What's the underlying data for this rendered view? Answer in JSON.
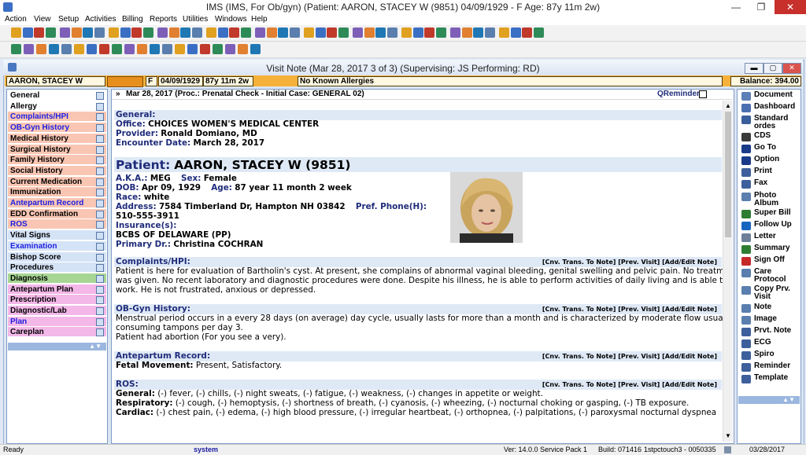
{
  "app": {
    "title": "IMS (IMS, For Ob/gyn)     (Patient: AARON, STACEY W (9851) 04/09/1929 - F Age: 87y 11m 2w)"
  },
  "window_controls": {
    "minimize": "—",
    "maximize": "❐",
    "close": "✕"
  },
  "menu": [
    "Action",
    "View",
    "Setup",
    "Activities",
    "Billing",
    "Reports",
    "Utilities",
    "Windows",
    "Help"
  ],
  "visit_window": {
    "title": "Visit Note (Mar 28, 2017    3 of 3) (Supervising: JS Performing: RD)"
  },
  "patient_bar": {
    "name": "AARON, STACEY W",
    "sex": "F",
    "dob": "04/09/1929",
    "age": "87y 11m 2w",
    "allergies": "No Known Allergies",
    "balance": "Balance: 394.00"
  },
  "left_nav": [
    {
      "label": "General",
      "color": "#ffffff",
      "text": "#000000"
    },
    {
      "label": "Allergy",
      "color": "#ffffff",
      "text": "#000000"
    },
    {
      "label": "Complaints/HPI",
      "color": "#f9c6b3",
      "text": "#1d1de0"
    },
    {
      "label": "OB-Gyn History",
      "color": "#f9c6b3",
      "text": "#1d1de0"
    },
    {
      "label": "Medical History",
      "color": "#f9c6b3",
      "text": "#000000"
    },
    {
      "label": "Surgical History",
      "color": "#f9c6b3",
      "text": "#000000"
    },
    {
      "label": "Family History",
      "color": "#f9c6b3",
      "text": "#000000"
    },
    {
      "label": "Social History",
      "color": "#f9c6b3",
      "text": "#000000"
    },
    {
      "label": "Current Medication",
      "color": "#f9c6b3",
      "text": "#000000"
    },
    {
      "label": "Immunization",
      "color": "#f9c6b3",
      "text": "#000000"
    },
    {
      "label": "Antepartum Record",
      "color": "#f9c6b3",
      "text": "#1d1de0"
    },
    {
      "label": "EDD Confirmation",
      "color": "#f9c6b3",
      "text": "#000000"
    },
    {
      "label": "ROS",
      "color": "#f9c6b3",
      "text": "#1d1de0"
    },
    {
      "label": "Vital Signs",
      "color": "#d5e3f6",
      "text": "#000000"
    },
    {
      "label": "Examination",
      "color": "#d5e3f6",
      "text": "#1d1de0"
    },
    {
      "label": "Bishop Score",
      "color": "#d5e3f6",
      "text": "#000000"
    },
    {
      "label": "Procedures",
      "color": "#d5e3f6",
      "text": "#000000"
    },
    {
      "label": "Diagnosis",
      "color": "#a7d694",
      "text": "#000000"
    },
    {
      "label": "Antepartum Plan",
      "color": "#f3b7e8",
      "text": "#000000"
    },
    {
      "label": "Prescription",
      "color": "#f3b7e8",
      "text": "#000000"
    },
    {
      "label": "Diagnostic/Lab",
      "color": "#f3b7e8",
      "text": "#000000"
    },
    {
      "label": "Plan",
      "color": "#f3b7e8",
      "text": "#1d1de0"
    },
    {
      "label": "Careplan",
      "color": "#f3b7e8",
      "text": "#000000"
    }
  ],
  "visit_header": {
    "text": "Mar 28, 2017  (Proc.: Prenatal Check - Initial  Case: GENERAL 02)",
    "qreminder": "QReminder"
  },
  "note": {
    "general_header": "General:",
    "office_label": "Office:",
    "office": "CHOICES WOMEN'S MEDICAL CENTER",
    "provider_label": "Provider:",
    "provider": "Ronald Domiano, MD",
    "encounter_label": "Encounter Date:",
    "encounter": "March 28, 2017",
    "patient_label": "Patient:",
    "patient": "AARON, STACEY W  (9851)",
    "aka_label": "A.K.A.:",
    "aka": "MEG",
    "sex_label": "Sex:",
    "sex": "Female",
    "dob_label": "DOB:",
    "dob": "Apr 09, 1929",
    "age_label": "Age:",
    "age": "87 year 11 month 2 week",
    "race_label": "Race:",
    "race": "white",
    "address_label": "Address:",
    "address": "7584 Timberland Dr, Hampton NH 03842",
    "phone_label": "Pref. Phone(H):",
    "phone": "510-555-3911",
    "insurance_label": "Insurance(s):",
    "insurance": "BCBS OF DELAWARE (PP)",
    "primary_label": "Primary Dr.:",
    "primary": "Christina COCHRAN",
    "link_cnv": "[Cnv. Trans. To Note]",
    "link_prev": "[Prev. Visit]",
    "link_add": "[Add/Edit Note]",
    "hpi_header": "Complaints/HPI:",
    "hpi_1": "Patient is here for evaluation of Bartholin's cyst. At present, she complains of abnormal vaginal bleeding, genital swelling and pelvic pain. No treatment",
    "hpi_2": "was given. No recent laboratory and diagnostic procedures were done. Despite his illness, he is able to perform activities of daily living and is able to",
    "hpi_3": "work. He is not frustrated, anxious or depressed.",
    "obgyn_header": "OB-Gyn History:",
    "obgyn_1": "Menstrual period occurs in a every 28 days (on average)  day cycle, usually lasts for more than a month and is characterized by moderate flow usually",
    "obgyn_2": "consuming tampons per day 3.",
    "obgyn_3": "Patient had abortion (For you see a very).",
    "ante_header": "Antepartum Record:",
    "fetal_label": "Fetal Movement:",
    "fetal": "Present, Satisfactory.",
    "ros_header": "ROS:",
    "ros_gen_label": "General:",
    "ros_gen": "(-) fever, (-) chills, (-) night sweats, (-) fatigue, (-) weakness, (-) changes in appetite or weight.",
    "ros_resp_label": "Respiratory:",
    "ros_resp": "(-) cough, (-) hemoptysis, (-) shortness of breath, (-) cyanosis, (-) wheezing, (-) nocturnal choking or gasping, (-) TB exposure.",
    "ros_card_label": "Cardiac:",
    "ros_card": "(-) chest pain, (-) edema, (-) high blood pressure, (-) irregular heartbeat, (-) orthopnea, (-) palpitations, (-) paroxysmal nocturnal dyspnea"
  },
  "right_panel": [
    {
      "label": "Document",
      "color": "#5d7fb8"
    },
    {
      "label": "Dashboard",
      "color": "#4a6fae"
    },
    {
      "label": "Standard ordes",
      "color": "#3a5e9a"
    },
    {
      "label": "CDS",
      "color": "#3a3a3a"
    },
    {
      "label": "Go To",
      "color": "#1a3a8a"
    },
    {
      "label": "Option",
      "color": "#1a3a8a"
    },
    {
      "label": "Print",
      "color": "#3d5f9c"
    },
    {
      "label": "Fax",
      "color": "#3d5f9c"
    },
    {
      "label": "Photo Album",
      "color": "#5a7fae"
    },
    {
      "label": "Super Bill",
      "color": "#2e7d32"
    },
    {
      "label": "Follow Up",
      "color": "#1565c0"
    },
    {
      "label": "Letter",
      "color": "#6d7f99"
    },
    {
      "label": "Summary",
      "color": "#2e7d32"
    },
    {
      "label": "Sign Off",
      "color": "#c62828"
    },
    {
      "label": "Care Protocol",
      "color": "#5a7fae"
    },
    {
      "label": "Copy Prv. Visit",
      "color": "#5a7fae"
    },
    {
      "label": "Note",
      "color": "#5a7fae"
    },
    {
      "label": "Image",
      "color": "#5a7fae"
    },
    {
      "label": "Prvt. Note",
      "color": "#3d5f9c"
    },
    {
      "label": "ECG",
      "color": "#3d5f9c"
    },
    {
      "label": "Spiro",
      "color": "#3d5f9c"
    },
    {
      "label": "Reminder",
      "color": "#3d5f9c"
    },
    {
      "label": "Template",
      "color": "#3d5f9c"
    }
  ],
  "status": {
    "ready": "Ready",
    "user": "system",
    "version": "Ver: 14.0.0 Service Pack 1",
    "build": "Build: 071416",
    "station": "1stpctouch3 - 0050335",
    "date": "03/28/2017"
  }
}
